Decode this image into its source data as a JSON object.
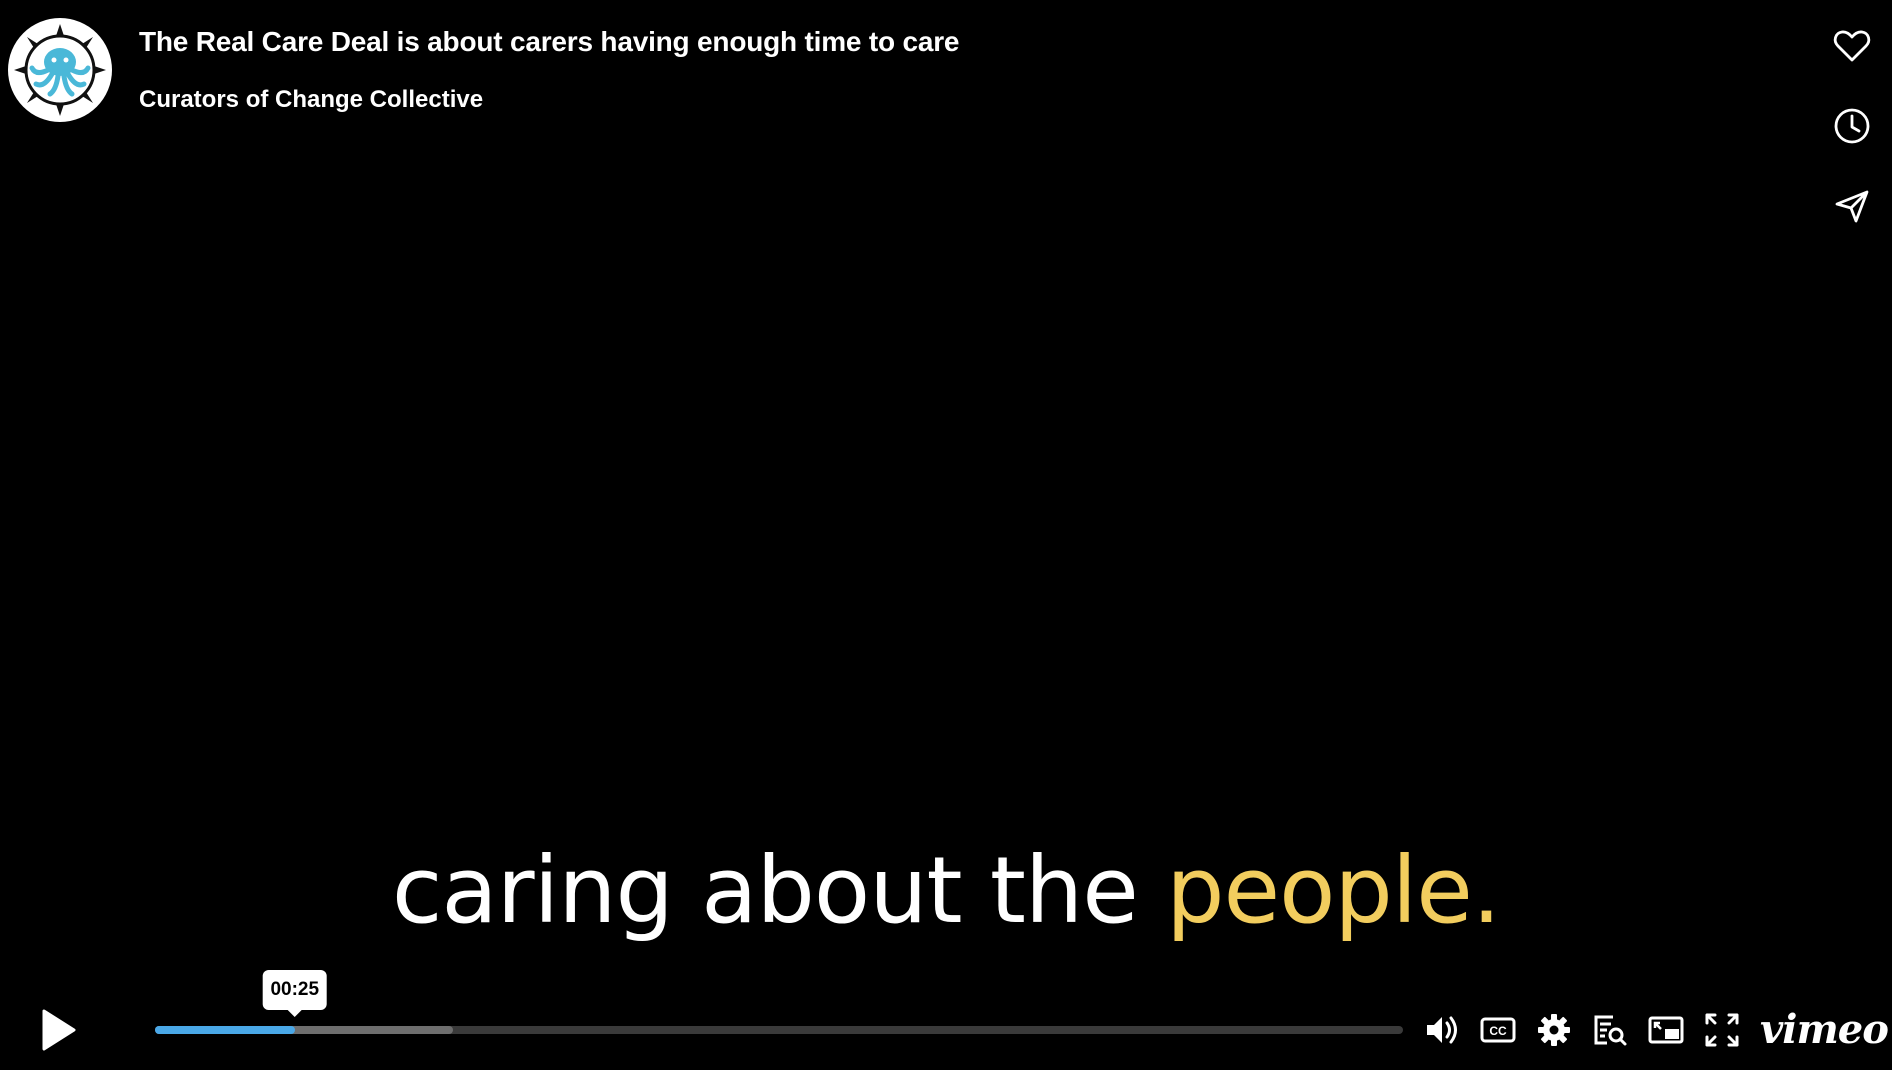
{
  "video": {
    "title": "The Real Care Deal is about carers having enough time to care",
    "author": "Curators of Change Collective",
    "caption_main": "caring about the ",
    "caption_highlight": "people."
  },
  "side_actions": {
    "like_icon": "heart-icon",
    "watch_later_icon": "clock-icon",
    "share_icon": "paper-plane-icon"
  },
  "player": {
    "hover_time": "00:25",
    "played_fraction": 0.112,
    "buffered_fraction": 0.239,
    "brand": "vimeo",
    "colors": {
      "progress": "#4aa8e8",
      "caption_highlight": "#f2cd5e",
      "avatar_accent": "#4ab8d8"
    }
  }
}
